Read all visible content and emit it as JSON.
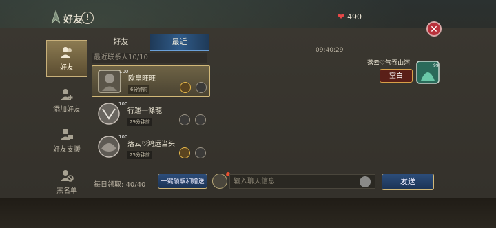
{
  "header": {
    "title": "好友",
    "info_label": "!",
    "hearts_count": "490"
  },
  "nav": {
    "items": [
      {
        "label": "好友",
        "icon": "friends-icon",
        "active": true
      },
      {
        "label": "添加好友",
        "icon": "add-friend-icon",
        "active": false
      },
      {
        "label": "好友支援",
        "icon": "friend-support-icon",
        "active": false
      },
      {
        "label": "黑名单",
        "icon": "blacklist-icon",
        "active": false
      }
    ]
  },
  "tabs": {
    "friends": "好友",
    "recent": "最近"
  },
  "recent_contacts_label": "最近联系人10/10",
  "contacts": [
    {
      "name": "欧皇旺旺",
      "time": "6分钟前",
      "level": "100",
      "gift_lit": true,
      "selected": true
    },
    {
      "name": "行運一條龍",
      "time": "29分钟前",
      "level": "100",
      "gift_lit": false,
      "selected": false
    },
    {
      "name": "落云♡鸿运当头",
      "time": "25分钟前",
      "level": "100",
      "gift_lit": true,
      "selected": false
    }
  ],
  "bottom": {
    "daily_claim": "每日领取: 40/40",
    "claim_all_button": "一键领取和赠送",
    "chat_placeholder": "输入聊天信息",
    "send_button": "发送"
  },
  "chat": {
    "time": "09:40:29",
    "sender": "落云♡气吞山河",
    "message": "空白",
    "sender_level": "99"
  },
  "colors": {
    "accent_gold": "#d2b878",
    "button_blue": "#2c4d7a",
    "close_red": "#b8303a"
  }
}
